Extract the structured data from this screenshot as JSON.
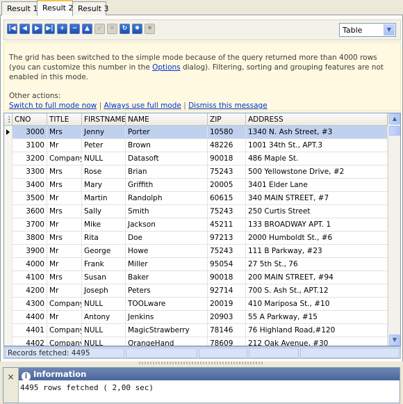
{
  "tabs": [
    {
      "label": "Result 1"
    },
    {
      "label": "Result 2"
    },
    {
      "label": "Result 3"
    }
  ],
  "toolbar": {
    "buttons": [
      {
        "icon": "first-record-icon",
        "glyph": "|◀",
        "enabled": true
      },
      {
        "icon": "prior-record-icon",
        "glyph": "◀",
        "enabled": true
      },
      {
        "icon": "next-record-icon",
        "glyph": "▶",
        "enabled": true
      },
      {
        "icon": "last-record-icon",
        "glyph": "▶|",
        "enabled": true
      },
      {
        "icon": "insert-record-icon",
        "glyph": "+",
        "enabled": true
      },
      {
        "icon": "delete-record-icon",
        "glyph": "−",
        "enabled": true
      },
      {
        "icon": "edit-record-icon",
        "glyph": "▲",
        "enabled": true
      },
      {
        "icon": "post-edit-icon",
        "glyph": "✓",
        "enabled": false
      },
      {
        "icon": "cancel-edit-icon",
        "glyph": "✕",
        "enabled": false
      },
      {
        "icon": "refresh-icon",
        "glyph": "↻",
        "enabled": true
      },
      {
        "icon": "apply-updates-icon",
        "glyph": "✸",
        "enabled": true
      },
      {
        "icon": "commit-icon",
        "glyph": "✸",
        "enabled": false
      }
    ],
    "view_select": "Table"
  },
  "notice": {
    "text_before": "The grid has been switched to the simple mode because of the query returned more than 4000 rows (you can customize this number in the ",
    "options_link": "Options",
    "text_after": " dialog). Filtering, sorting and grouping features are not enabled in this mode.",
    "other_actions": "Other actions:",
    "action_full_mode": "Switch to full mode now",
    "action_always": "Always use full mode",
    "action_dismiss": "Dismiss this message",
    "separator": "|"
  },
  "grid": {
    "columns": [
      "CNO",
      "TITLE",
      "FIRSTNAME",
      "NAME",
      "ZIP",
      "ADDRESS"
    ],
    "rows": [
      [
        "3000",
        "Mrs",
        "Jenny",
        "Porter",
        "10580",
        "1340 N. Ash Street, #3"
      ],
      [
        "3100",
        "Mr",
        "Peter",
        "Brown",
        "48226",
        "1001 34th St., APT.3"
      ],
      [
        "3200",
        "Company",
        "NULL",
        "Datasoft",
        "90018",
        "486 Maple St."
      ],
      [
        "3300",
        "Mrs",
        "Rose",
        "Brian",
        "75243",
        "500 Yellowstone Drive, #2"
      ],
      [
        "3400",
        "Mrs",
        "Mary",
        "Griffith",
        "20005",
        "3401 Elder Lane"
      ],
      [
        "3500",
        "Mr",
        "Martin",
        "Randolph",
        "60615",
        "340 MAIN STREET, #7"
      ],
      [
        "3600",
        "Mrs",
        "Sally",
        "Smith",
        "75243",
        "250 Curtis Street"
      ],
      [
        "3700",
        "Mr",
        "Mike",
        "Jackson",
        "45211",
        "133 BROADWAY APT. 1"
      ],
      [
        "3800",
        "Mrs",
        "Rita",
        "Doe",
        "97213",
        "2000 Humboldt St., #6"
      ],
      [
        "3900",
        "Mr",
        "George",
        "Howe",
        "75243",
        "111 B Parkway, #23"
      ],
      [
        "4000",
        "Mr",
        "Frank",
        "Miller",
        "95054",
        "27 5th St., 76"
      ],
      [
        "4100",
        "Mrs",
        "Susan",
        "Baker",
        "90018",
        "200 MAIN STREET, #94"
      ],
      [
        "4200",
        "Mr",
        "Joseph",
        "Peters",
        "92714",
        "700 S. Ash St., APT.12"
      ],
      [
        "4300",
        "Company",
        "NULL",
        "TOOLware",
        "20019",
        "410 Mariposa St., #10"
      ],
      [
        "4400",
        "Mr",
        "Antony",
        "Jenkins",
        "20903",
        "55 A Parkway, #15"
      ],
      [
        "4401",
        "Company",
        "NULL",
        "MagicStrawberry",
        "78146",
        "76 Highland Road,#120"
      ],
      [
        "4402",
        "Company",
        "NULL",
        "OrangeHand",
        "78609",
        "212 Oak Avenue, #30"
      ]
    ],
    "selected_row": 0
  },
  "status": {
    "records": "Records fetched: 4495"
  },
  "info": {
    "title": "Information",
    "close": "×",
    "message": "4495 rows fetched ( 2,00 sec)"
  }
}
